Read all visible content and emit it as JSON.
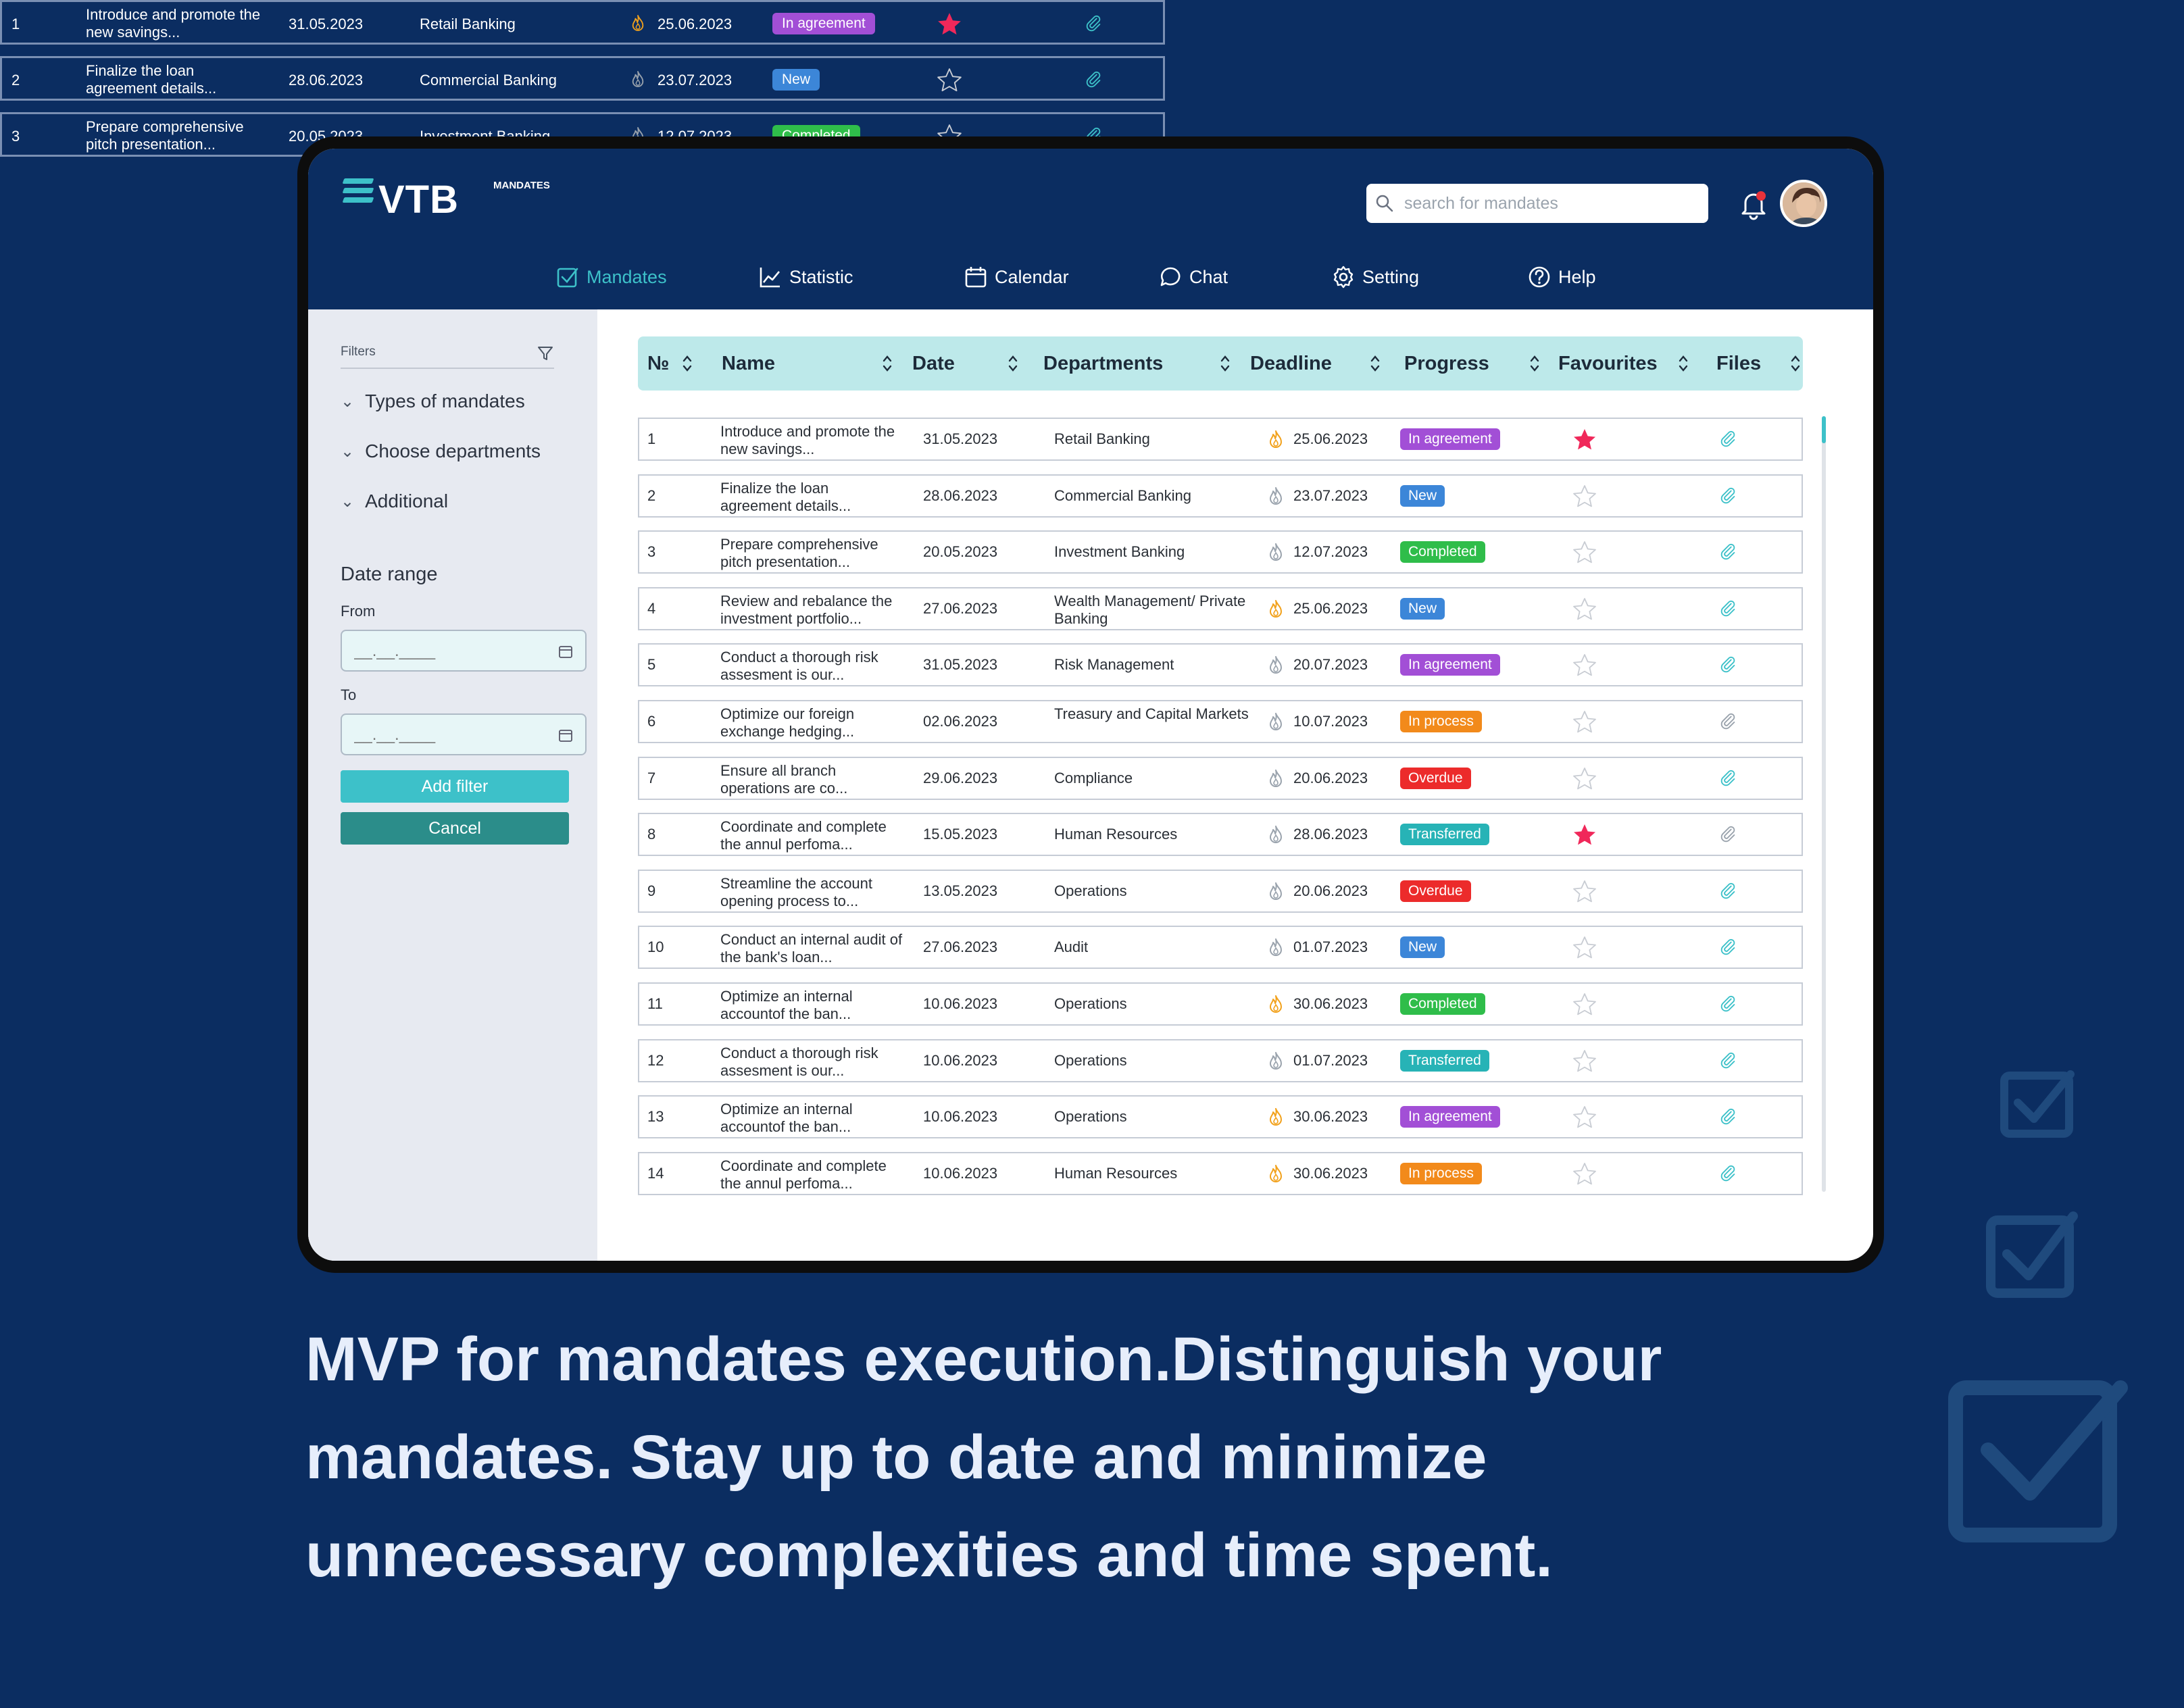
{
  "colors": {
    "background": "#0b2d61",
    "accent": "#3dc1c9",
    "cancel": "#2b8d8a",
    "status": {
      "In agreement": "#a24fd6",
      "New": "#3c86d8",
      "Completed": "#2fbd4a",
      "In process": "#f28a1b",
      "Overdue": "#ec2b2b",
      "Transferred": "#27b3b6"
    },
    "star_active": "#f0285a",
    "flame_hot": "#f2a11b",
    "flame_cold": "#9aa3ad"
  },
  "background_table": {
    "rows": [
      {
        "no": "1",
        "name": "Introduce and promote the new savings...",
        "date": "31.05.2023",
        "department": "Retail Banking",
        "deadline": "25.06.2023",
        "hot": true,
        "status": "In agreement",
        "favourite": true
      },
      {
        "no": "2",
        "name": "Finalize the loan agreement details...",
        "date": "28.06.2023",
        "department": "Commercial Banking",
        "deadline": "23.07.2023",
        "hot": false,
        "status": "New",
        "favourite": false
      },
      {
        "no": "3",
        "name": "Prepare comprehensive pitch presentation...",
        "date": "20.05.2023",
        "department": "Investment Banking",
        "deadline": "12.07.2023",
        "hot": false,
        "status": "Completed",
        "favourite": false
      }
    ]
  },
  "app": {
    "logo": {
      "main": "VTB",
      "sub": "MANDATES"
    },
    "search": {
      "placeholder": "search for mandates",
      "icon": "search-icon"
    },
    "notifications": {
      "icon": "bell-icon",
      "has_unread": true
    },
    "nav": [
      {
        "label": "Mandates",
        "icon": "checkbox-icon",
        "active": true
      },
      {
        "label": "Statistic",
        "icon": "chart-line-icon",
        "active": false
      },
      {
        "label": "Calendar",
        "icon": "calendar-icon",
        "active": false
      },
      {
        "label": "Chat",
        "icon": "chat-bubble-icon",
        "active": false
      },
      {
        "label": "Setting",
        "icon": "gear-icon",
        "active": false
      },
      {
        "label": "Help",
        "icon": "help-circle-icon",
        "active": false
      }
    ]
  },
  "sidebar": {
    "filters_label": "Filters",
    "sections": [
      "Types of mandates",
      "Choose departments",
      "Additional"
    ],
    "date_range": {
      "title": "Date range",
      "from_label": "From",
      "to_label": "To",
      "from_placeholder": "__.__.____",
      "to_placeholder": "__.__.____"
    },
    "add_filter_label": "Add filter",
    "cancel_label": "Cancel"
  },
  "table": {
    "columns": [
      "№",
      "Name",
      "Date",
      "Departments",
      "Deadline",
      "Progress",
      "Favourites",
      "Files"
    ],
    "rows": [
      {
        "no": "1",
        "name": "Introduce and promote the new savings...",
        "date": "31.05.2023",
        "department": "Retail Banking",
        "deadline": "25.06.2023",
        "hot": true,
        "status": "In agreement",
        "favourite": true,
        "file_active": true
      },
      {
        "no": "2",
        "name": "Finalize the loan agreement details...",
        "date": "28.06.2023",
        "department": "Commercial Banking",
        "deadline": "23.07.2023",
        "hot": false,
        "status": "New",
        "favourite": false,
        "file_active": true
      },
      {
        "no": "3",
        "name": "Prepare comprehensive pitch presentation...",
        "date": "20.05.2023",
        "department": "Investment Banking",
        "deadline": "12.07.2023",
        "hot": false,
        "status": "Completed",
        "favourite": false,
        "file_active": true
      },
      {
        "no": "4",
        "name": "Review and rebalance the investment portfolio...",
        "date": "27.06.2023",
        "department": "Wealth Management/ Private Banking",
        "deadline": "25.06.2023",
        "hot": true,
        "status": "New",
        "favourite": false,
        "file_active": true
      },
      {
        "no": "5",
        "name": "Conduct a thorough risk assesment is our...",
        "date": "31.05.2023",
        "department": "Risk Management",
        "deadline": "20.07.2023",
        "hot": false,
        "status": "In agreement",
        "favourite": false,
        "file_active": true
      },
      {
        "no": "6",
        "name": "Optimize our foreign exchange hedging...",
        "date": "02.06.2023",
        "department": "Treasury and Capital Markets",
        "deadline": "10.07.2023",
        "hot": false,
        "status": "In process",
        "favourite": false,
        "file_active": false
      },
      {
        "no": "7",
        "name": "Ensure all branch operations are co...",
        "date": "29.06.2023",
        "department": "Compliance",
        "deadline": "20.06.2023",
        "hot": false,
        "status": "Overdue",
        "favourite": false,
        "file_active": true
      },
      {
        "no": "8",
        "name": "Coordinate and complete the annul perfoma...",
        "date": "15.05.2023",
        "department": "Human Resources",
        "deadline": "28.06.2023",
        "hot": false,
        "status": "Transferred",
        "favourite": true,
        "file_active": false
      },
      {
        "no": "9",
        "name": "Streamline the account opening process to...",
        "date": "13.05.2023",
        "department": "Operations",
        "deadline": "20.06.2023",
        "hot": false,
        "status": "Overdue",
        "favourite": false,
        "file_active": true
      },
      {
        "no": "10",
        "name": "Conduct an internal audit of the bank's loan...",
        "date": "27.06.2023",
        "department": "Audit",
        "deadline": "01.07.2023",
        "hot": false,
        "status": "New",
        "favourite": false,
        "file_active": true
      },
      {
        "no": "11",
        "name": "Optimize an internal accountof the ban...",
        "date": "10.06.2023",
        "department": "Operations",
        "deadline": "30.06.2023",
        "hot": true,
        "status": "Completed",
        "favourite": false,
        "file_active": true
      },
      {
        "no": "12",
        "name": "Conduct a thorough risk assesment is our...",
        "date": "10.06.2023",
        "department": "Operations",
        "deadline": "01.07.2023",
        "hot": false,
        "status": "Transferred",
        "favourite": false,
        "file_active": true
      },
      {
        "no": "13",
        "name": "Optimize an internal accountof the ban...",
        "date": "10.06.2023",
        "department": "Operations",
        "deadline": "30.06.2023",
        "hot": true,
        "status": "In agreement",
        "favourite": false,
        "file_active": true
      },
      {
        "no": "14",
        "name": "Coordinate and complete the annul perfoma...",
        "date": "10.06.2023",
        "department": "Human Resources",
        "deadline": "30.06.2023",
        "hot": true,
        "status": "In process",
        "favourite": false,
        "file_active": true
      }
    ]
  },
  "caption": "MVP for mandates execution.Distinguish your mandates. Stay up to date and minimize unnecessary complexities and time spent."
}
